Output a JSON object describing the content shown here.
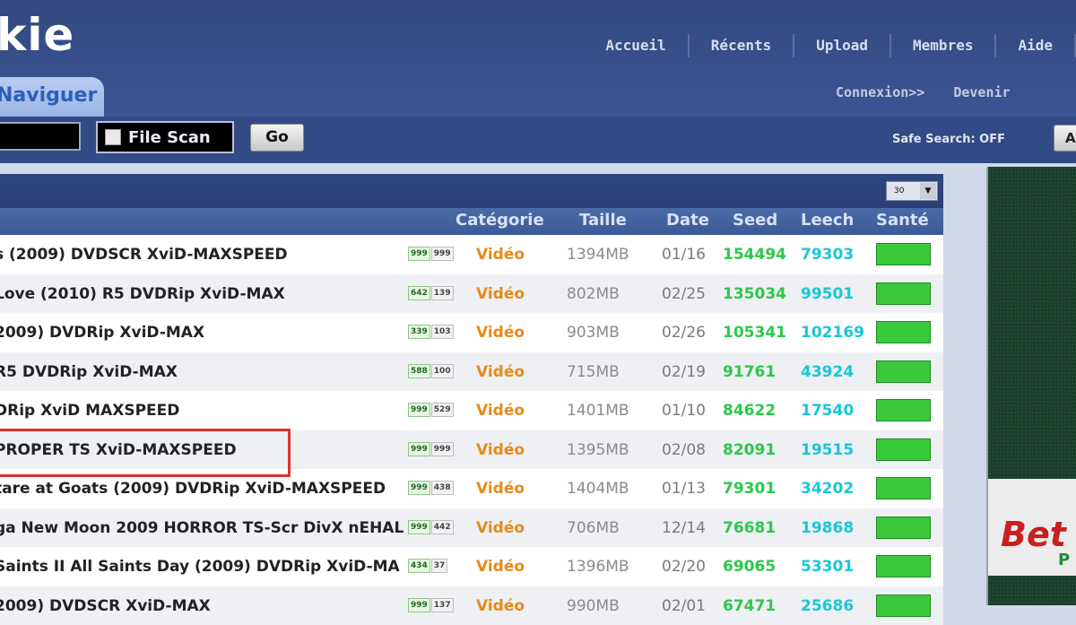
{
  "header": {
    "logo": "kie",
    "nav": [
      "Accueil",
      "Récents",
      "Upload",
      "Membres",
      "Aide"
    ],
    "tab": "Naviguer",
    "auth": [
      "Connexion>>",
      "Devenir"
    ]
  },
  "search": {
    "file_scan_label": "File Scan",
    "go_label": "Go",
    "safe_search": "Safe Search: OFF",
    "safe_button": "A"
  },
  "table": {
    "per_page": "30",
    "columns": [
      "Catégorie",
      "Taille",
      "Date",
      "Seed",
      "Leech",
      "Santé"
    ],
    "rows": [
      {
        "name": "s (2009) DVDSCR XviD-MAXSPEED",
        "b1": "999",
        "b2": "999",
        "category": "Vidéo",
        "size": "1394MB",
        "date": "01/16",
        "seed": "154494",
        "leech": "79303"
      },
      {
        "name": " Love (2010) R5 DVDRip XviD-MAX",
        "b1": "642",
        "b2": "139",
        "category": "Vidéo",
        "size": "802MB",
        "date": "02/25",
        "seed": "135034",
        "leech": "99501"
      },
      {
        "name": "2009) DVDRip XviD-MAX",
        "b1": "339",
        "b2": "103",
        "category": "Vidéo",
        "size": "903MB",
        "date": "02/26",
        "seed": "105341",
        "leech": "102169"
      },
      {
        "name": "R5 DVDRip XviD-MAX",
        "b1": "588",
        "b2": "100",
        "category": "Vidéo",
        "size": "715MB",
        "date": "02/19",
        "seed": "91761",
        "leech": "43924"
      },
      {
        "name": "DRip XviD MAXSPEED",
        "b1": "999",
        "b2": "529",
        "category": "Vidéo",
        "size": "1401MB",
        "date": "01/10",
        "seed": "84622",
        "leech": "17540"
      },
      {
        "name": "PROPER TS XviD-MAXSPEED",
        "b1": "999",
        "b2": "999",
        "category": "Vidéo",
        "size": "1395MB",
        "date": "02/08",
        "seed": "82091",
        "leech": "19515"
      },
      {
        "name": "tare at Goats (2009) DVDRip XviD-MAXSPEED",
        "b1": "999",
        "b2": "438",
        "category": "Vidéo",
        "size": "1404MB",
        "date": "01/13",
        "seed": "79301",
        "leech": "34202"
      },
      {
        "name": "ga New Moon 2009 HORROR TS-Scr DivX nEHAL",
        "b1": "999",
        "b2": "442",
        "category": "Vidéo",
        "size": "706MB",
        "date": "12/14",
        "seed": "76681",
        "leech": "19868"
      },
      {
        "name": "Saints II All Saints Day (2009) DVDRip XviD-MA",
        "b1": "434",
        "b2": "37",
        "category": "Vidéo",
        "size": "1396MB",
        "date": "02/20",
        "seed": "69065",
        "leech": "53301"
      },
      {
        "name": "2009) DVDSCR XviD-MAX",
        "b1": "999",
        "b2": "137",
        "category": "Vidéo",
        "size": "990MB",
        "date": "02/01",
        "seed": "67471",
        "leech": "25686"
      }
    ]
  },
  "ad": {
    "line1": "Bet",
    "line2": "P"
  },
  "colors": {
    "accent": "#3a5290",
    "category": "#e58a1a",
    "seed": "#2cc84a",
    "leech": "#19c7d6",
    "health": "#3ac93a",
    "highlight": "#e03030"
  }
}
